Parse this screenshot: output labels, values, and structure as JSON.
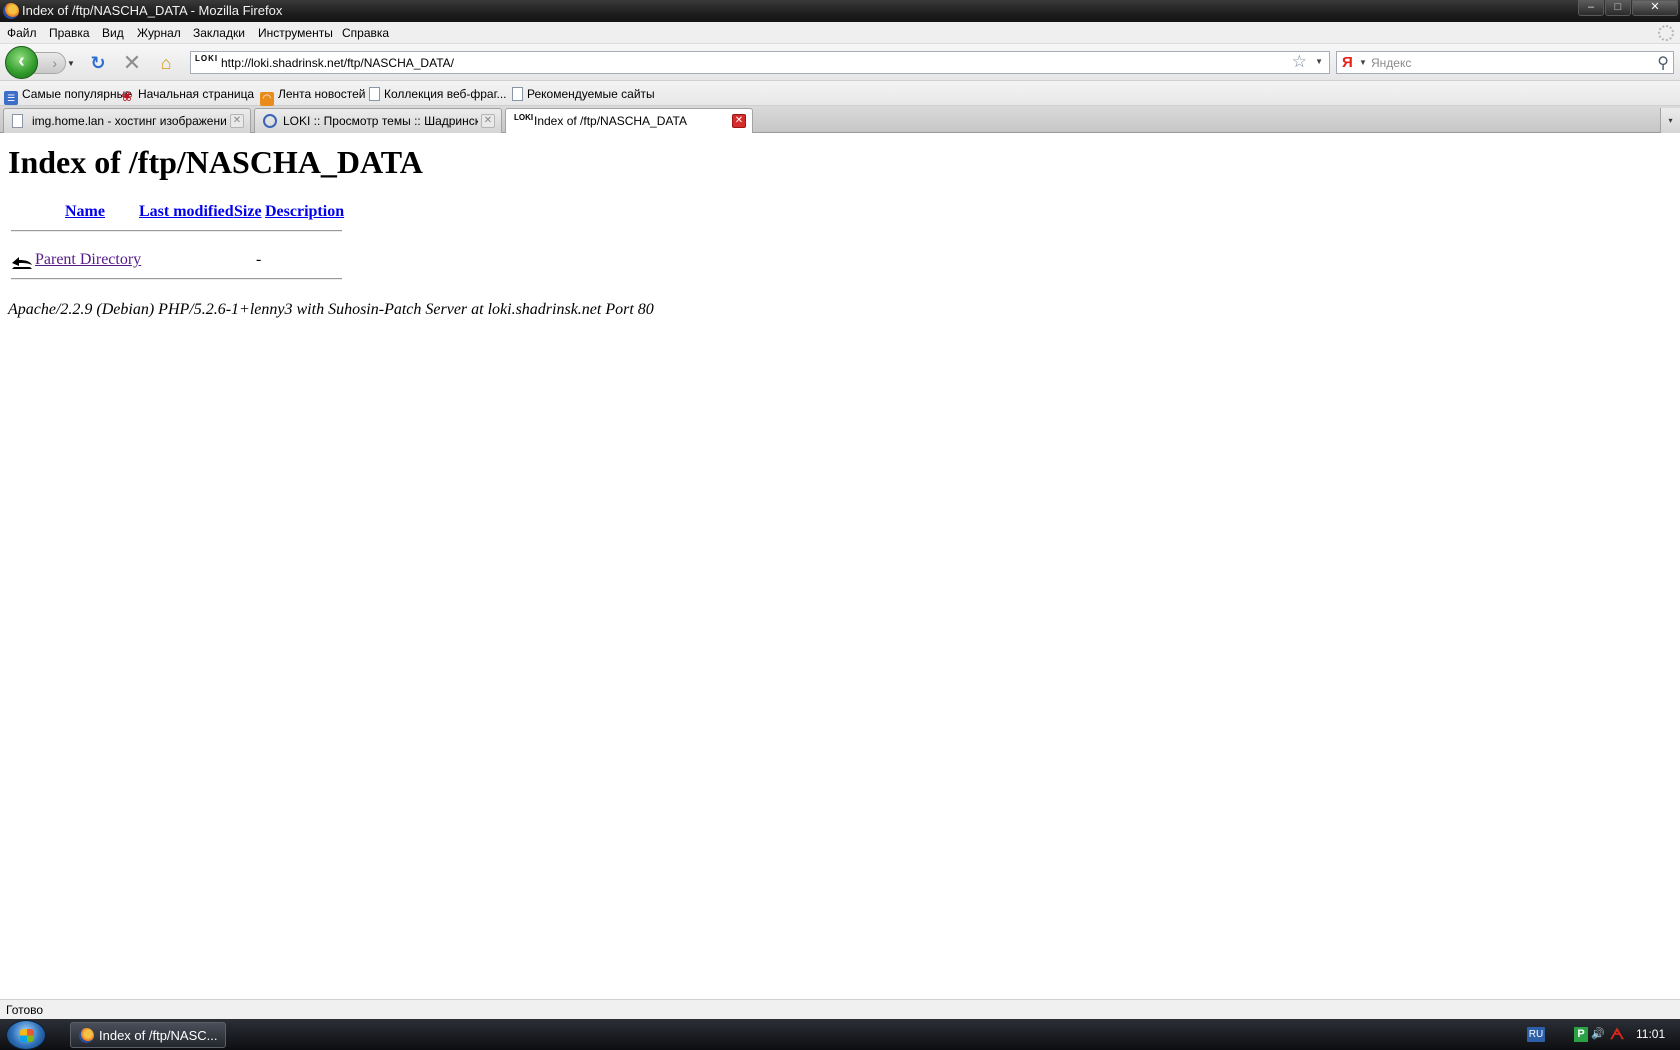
{
  "window": {
    "title": "Index of /ftp/NASCHA_DATA - Mozilla Firefox",
    "controls": {
      "minimize": "–",
      "maximize": "□",
      "close": "✕"
    }
  },
  "menu": {
    "items": [
      {
        "label": "Файл"
      },
      {
        "label": "Правка"
      },
      {
        "label": "Вид"
      },
      {
        "label": "Журнал"
      },
      {
        "label": "Закладки"
      },
      {
        "label": "Инструменты"
      },
      {
        "label": "Справка"
      }
    ]
  },
  "nav": {
    "back_glyph": "‹",
    "forward_glyph": "›",
    "reload_glyph": "↻",
    "stop_glyph": "✕",
    "home_glyph": "⌂",
    "url": "http://loki.shadrinsk.net/ftp/NASCHA_DATA/",
    "site_icon_text": "LOKI",
    "bookmark_star": "☆",
    "search": {
      "engine_glyph": "Я",
      "placeholder": "Яндекс",
      "go_glyph": "⚲"
    }
  },
  "bookmarks": {
    "items": [
      {
        "label": "Самые популярные",
        "icon": "popular-icon"
      },
      {
        "label": "Начальная страница",
        "icon": "start-page-icon"
      },
      {
        "label": "Лента новостей",
        "icon": "rss-icon"
      },
      {
        "label": "Коллекция веб-фраг...",
        "icon": "page-icon"
      },
      {
        "label": "Рекомендуемые сайты",
        "icon": "page-icon"
      }
    ]
  },
  "tabs": {
    "items": [
      {
        "label": "img.home.lan - хостинг изображений",
        "icon": "page-icon",
        "active": false
      },
      {
        "label": "LOKI :: Просмотр темы :: Шадрински...",
        "icon": "forum-icon",
        "active": false
      },
      {
        "label": "Index of /ftp/NASCHA_DATA",
        "icon": "loki-icon",
        "active": true
      }
    ],
    "close_glyph": "✕",
    "all_tabs_glyph": "▾"
  },
  "page": {
    "heading": "Index of /ftp/NASCHA_DATA",
    "columns": {
      "name": "Name",
      "last_modified": "Last modified",
      "size": "Size",
      "description": "Description"
    },
    "rows": [
      {
        "name": "Parent Directory",
        "last_modified": "",
        "size": "-",
        "description": ""
      }
    ],
    "address": "Apache/2.2.9 (Debian) PHP/5.2.6-1+lenny3 with Suhosin-Patch Server at loki.shadrinsk.net Port 80"
  },
  "status": {
    "text": "Готово"
  },
  "taskbar": {
    "window_button": "Index of /ftp/NASC...",
    "language": "RU",
    "tray_p": "P",
    "tray_volume": "🔊",
    "tray_antivirus": "ᗅ",
    "clock": "11:01"
  }
}
